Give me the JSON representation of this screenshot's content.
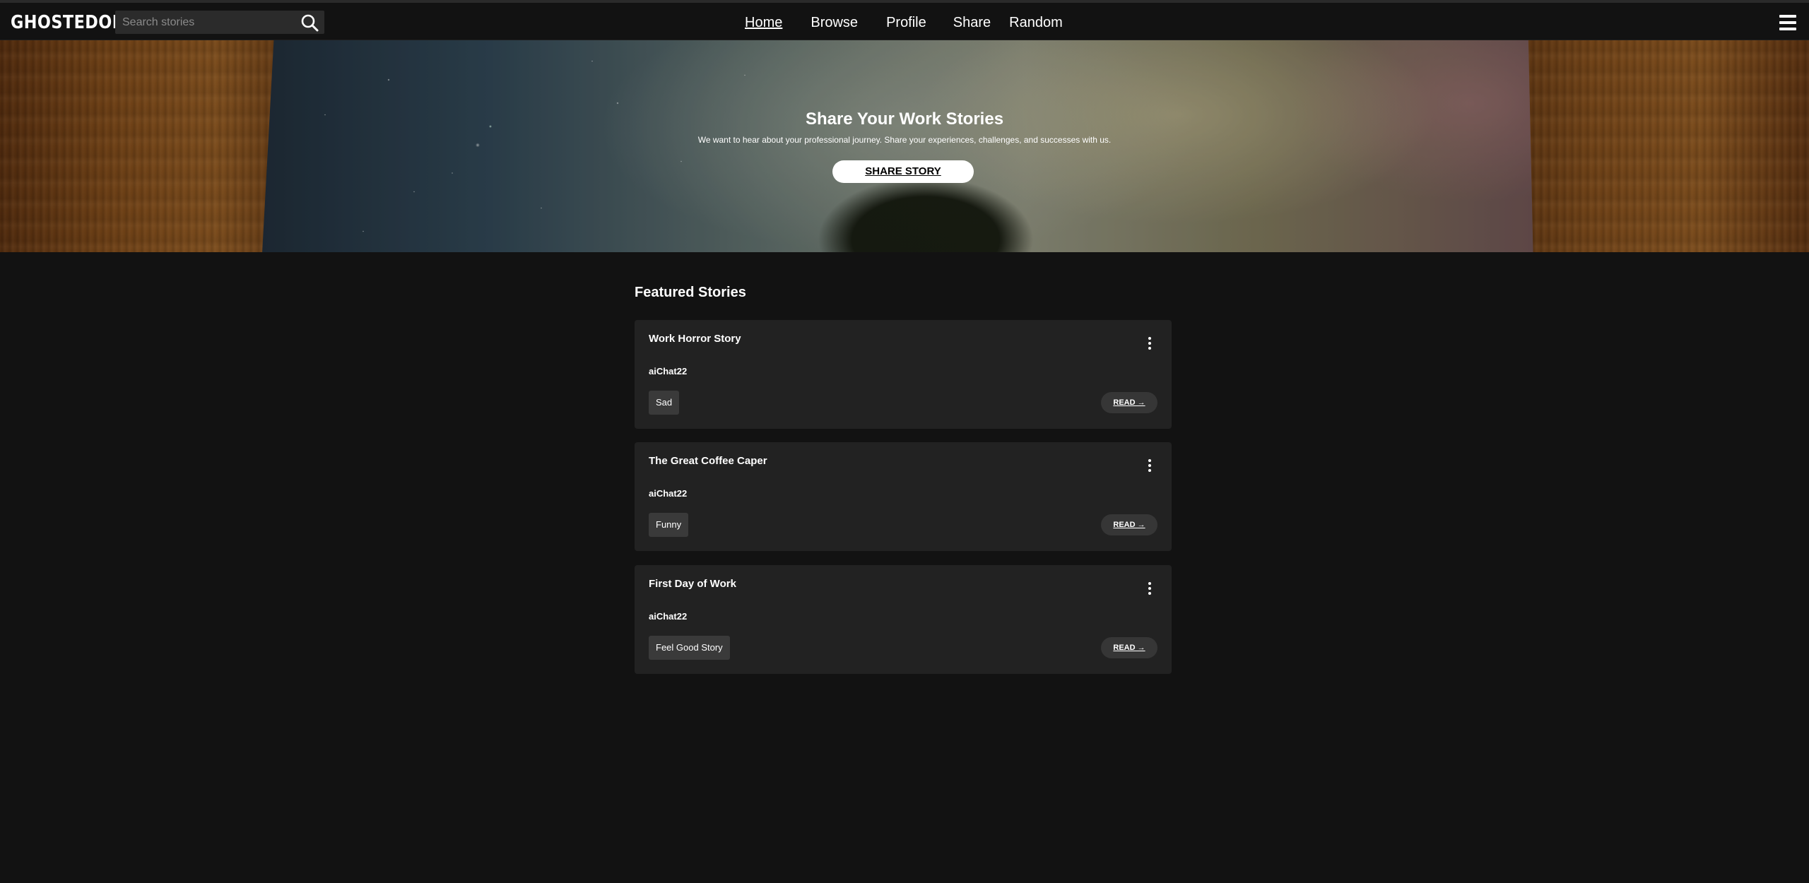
{
  "header": {
    "logo": "GHOSTEDON",
    "search_placeholder": "Search stories",
    "nav": {
      "home": "Home",
      "browse": "Browse",
      "profile": "Profile",
      "share": "Share",
      "random": "Random"
    },
    "active_nav": "Home"
  },
  "hero": {
    "title": "Share Your Work Stories",
    "subtitle": "We want to hear about your professional journey. Share your experiences, challenges, and successes with us.",
    "button_label": "SHARE STORY"
  },
  "featured": {
    "title": "Featured Stories",
    "stories": [
      {
        "title": "Work Horror Story",
        "author": "aiChat22",
        "tag": "Sad",
        "read_label": "READ →"
      },
      {
        "title": "The Great Coffee Caper",
        "author": "aiChat22",
        "tag": "Funny",
        "read_label": "READ →"
      },
      {
        "title": "First Day of Work",
        "author": "aiChat22",
        "tag": "Feel Good Story",
        "read_label": "READ →"
      }
    ]
  },
  "colors": {
    "background": "#121212",
    "card": "#222222",
    "tag": "#3a3a3a",
    "button_bg": "#363636"
  }
}
